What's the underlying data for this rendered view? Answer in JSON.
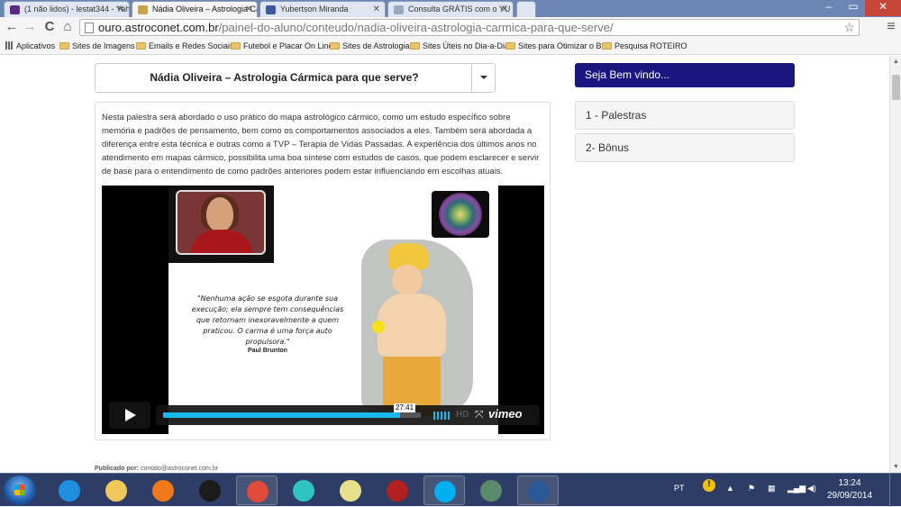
{
  "browser": {
    "tabs": [
      {
        "label": "(1 não lidos) - lestat344 - Yah",
        "icon": "mail-icon",
        "color": "#5b2a86"
      },
      {
        "label": "Nádia Oliveira – Astrologia Cá",
        "icon": "page-icon",
        "color": "#c7a34a",
        "active": true
      },
      {
        "label": "Yubertson Miranda",
        "icon": "facebook-icon",
        "color": "#3b5998"
      },
      {
        "label": "Consulta GRÁTIS com o YU",
        "icon": "page-icon",
        "color": "#9aa8c2"
      }
    ],
    "window_controls": [
      "–",
      "▭",
      "✕"
    ],
    "url_host": "ouro.astroconet.com.br",
    "url_path": "/painel-do-aluno/conteudo/nadia-oliveira-astrologia-carmica-para-que-serve/",
    "nav_icons": {
      "back": "←",
      "forward": "→",
      "reload": "C",
      "home": "⌂",
      "star": "☆",
      "menu": "≡"
    },
    "bookmarks": [
      {
        "label": "Aplicativos"
      },
      {
        "label": "Sites de Imagens"
      },
      {
        "label": "Emails e Redes Sociais"
      },
      {
        "label": "Futebol e Placar On Line"
      },
      {
        "label": "Sites de Astrologia"
      },
      {
        "label": "Sites Úteis no Dia-a-Dia"
      },
      {
        "label": "Sites para Otimizar o Bl..."
      },
      {
        "label": "Pesquisa ROTEIRO"
      }
    ]
  },
  "page": {
    "title": "Nádia Oliveira – Astrologia Cármica para que serve?",
    "description": "Nesta palestra será abordado o uso prático do mapa astrológico cármico, como um estudo específico sobre memória e padrões de pensamento, bem como os comportamentos associados a eles. Também será abordada a diferença entre esta técnica e outras como a TVP – Terapia de Vidas Passadas. A experiência dos últimos anos no atendimento em mapas cármico, possibilita uma boa síntese com estudos de casos. que podem esclarecer e servir de base para o entendimento de como padrões anteriores podem estar influenciando em escolhas atuais.",
    "video": {
      "quote": "\"Nenhuma ação se esgota durante sua execução; ela sempre tem consequências que retornam inexoravelmente a quem praticou. O carma é uma força auto propulsora.\"",
      "quote_author": "Paul Brunton",
      "timestamp": "27:41",
      "progress_fraction": 0.92,
      "hd_label": "HD",
      "brand": "vimeo",
      "accent": "#1ab7ea"
    },
    "publisher_label": "Publicado por:",
    "publisher_email": "contato@astroconet.com.br"
  },
  "sidebar": {
    "welcome": "Seja Bem vindo...",
    "items": [
      {
        "label": "1 - Palestras"
      },
      {
        "label": "2- Bônus"
      }
    ]
  },
  "taskbar": {
    "apps": [
      {
        "name": "internet-explorer-icon",
        "color": "#1f8fe0"
      },
      {
        "name": "file-explorer-icon",
        "color": "#f0c85a"
      },
      {
        "name": "media-player-icon",
        "color": "#f07a1a"
      },
      {
        "name": "hp-icon",
        "color": "#1b1b1b"
      },
      {
        "name": "chrome-icon",
        "color": "#dd4b39",
        "open": true
      },
      {
        "name": "vpn-icon",
        "color": "#2ec4c4"
      },
      {
        "name": "sticky-notes-icon",
        "color": "#e8e08a"
      },
      {
        "name": "speaker-app-icon",
        "color": "#b02020"
      },
      {
        "name": "skype-icon",
        "color": "#00aff0",
        "open": true
      },
      {
        "name": "window-app-icon",
        "color": "#5a8a6a"
      },
      {
        "name": "word-icon",
        "color": "#2b5797",
        "open": true
      }
    ],
    "language": "PT",
    "time": "13:24",
    "date": "29/09/2014"
  }
}
